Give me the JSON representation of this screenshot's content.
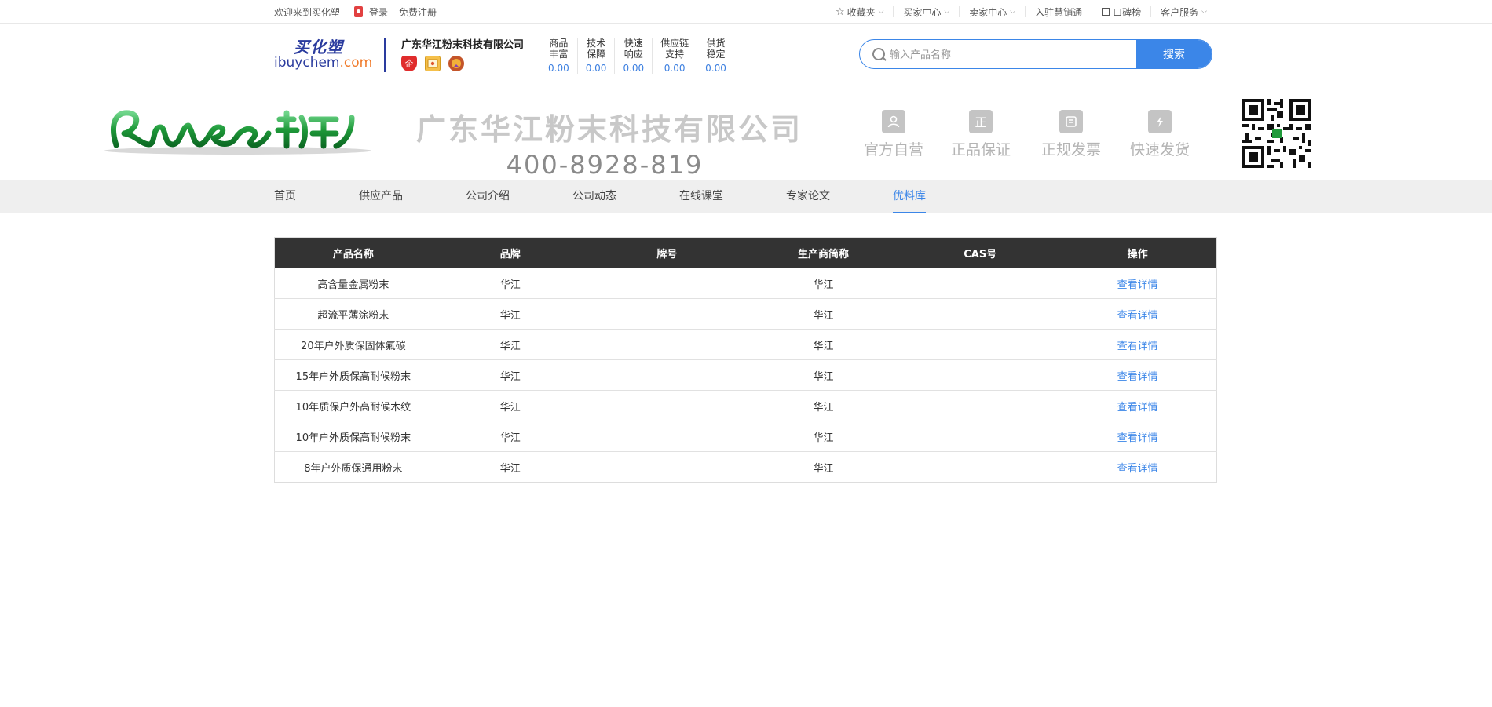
{
  "topbar": {
    "welcome": "欢迎来到买化塑",
    "login": "登录",
    "register": "免费注册",
    "favorites": "收藏夹",
    "buyer_center": "买家中心",
    "seller_center": "卖家中心",
    "join": "入驻慧销通",
    "ranking": "口碑榜",
    "service": "客户服务"
  },
  "header": {
    "logo_cn": "买化塑",
    "logo_en_a": "ibuychem",
    "logo_en_b": ".com",
    "company_name": "广东华江粉末科技有限公司",
    "badge_1": "企",
    "scores": [
      {
        "l1": "商品",
        "l2": "丰富",
        "value": "0.00"
      },
      {
        "l1": "技术",
        "l2": "保障",
        "value": "0.00"
      },
      {
        "l1": "快速",
        "l2": "响应",
        "value": "0.00"
      },
      {
        "l1": "供应链",
        "l2": "支持",
        "value": "0.00"
      },
      {
        "l1": "供货",
        "l2": "稳定",
        "value": "0.00"
      }
    ],
    "search_placeholder": "输入产品名称",
    "search_button": "搜索"
  },
  "banner": {
    "company_name": "广东华江粉末科技有限公司",
    "phone": "400-8928-819",
    "features": [
      {
        "label": "官方自营",
        "icon": "user-icon"
      },
      {
        "label": "正品保证",
        "icon": "zheng-icon",
        "glyph": "正"
      },
      {
        "label": "正规发票",
        "icon": "invoice-icon"
      },
      {
        "label": "快速发货",
        "icon": "lightning-icon"
      }
    ]
  },
  "nav": {
    "items": [
      "首页",
      "供应产品",
      "公司介绍",
      "公司动态",
      "在线课堂",
      "专家论文",
      "优料库"
    ],
    "active_index": 6
  },
  "table": {
    "headers": [
      "产品名称",
      "品牌",
      "牌号",
      "生产商简称",
      "CAS号",
      "操作"
    ],
    "action_label": "查看详情",
    "rows": [
      {
        "name": "高含量金属粉末",
        "brand": "华江",
        "grade": "",
        "maker": "华江",
        "cas": ""
      },
      {
        "name": "超流平薄涂粉末",
        "brand": "华江",
        "grade": "",
        "maker": "华江",
        "cas": ""
      },
      {
        "name": "20年户外质保固体氟碳",
        "brand": "华江",
        "grade": "",
        "maker": "华江",
        "cas": ""
      },
      {
        "name": "15年户外质保高耐候粉末",
        "brand": "华江",
        "grade": "",
        "maker": "华江",
        "cas": ""
      },
      {
        "name": "10年质保户外高耐候木纹",
        "brand": "华江",
        "grade": "",
        "maker": "华江",
        "cas": ""
      },
      {
        "name": "10年户外质保高耐候粉末",
        "brand": "华江",
        "grade": "",
        "maker": "华江",
        "cas": ""
      },
      {
        "name": "8年户外质保通用粉末",
        "brand": "华江",
        "grade": "",
        "maker": "华江",
        "cas": ""
      }
    ]
  },
  "colors": {
    "accent": "#3b86e8",
    "header_dark": "#333333",
    "logo_blue": "#2a3b9e",
    "brand_green": "#1f9a3a"
  }
}
